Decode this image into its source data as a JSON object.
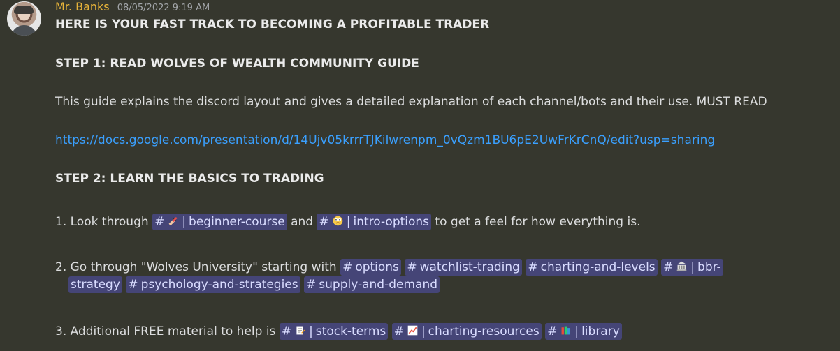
{
  "message": {
    "username": "Mr. Banks",
    "timestamp": "08/05/2022 9:19 AM",
    "title": "HERE IS YOUR FAST TRACK TO BECOMING A PROFITABLE TRADER",
    "step1_heading": "STEP 1:  READ WOLVES OF WEALTH COMMUNITY GUIDE",
    "step1_text": "This guide explains the discord layout and gives a detailed explanation of each channel/bots and their use. MUST READ",
    "guide_link": "https://docs.google.com/presentation/d/14Ujv05krrrTJKilwrenpm_0vQzm1BU6pE2UwFrKrCnQ/edit?usp=sharing",
    "step2_heading": "STEP 2: LEARN THE BASICS TO TRADING",
    "item1": {
      "prefix": "1. Look through",
      "middle": "and",
      "suffix": "to get a feel for how everything is.",
      "channel_a": "beginner-course",
      "channel_b": "intro-options"
    },
    "item2": {
      "prefix": "2. Go through \"Wolves University\" starting with",
      "channel_a": "options",
      "channel_b": "watchlist-trading",
      "channel_c": "charting-and-levels",
      "channel_d_start": "bbr-",
      "channel_d_end": "strategy",
      "channel_e": "psychology-and-strategies",
      "channel_f": "supply-and-demand"
    },
    "item3": {
      "prefix": "3. Additional FREE material to help is",
      "channel_a": "stock-terms",
      "channel_b": "charting-resources",
      "channel_c": "library"
    }
  },
  "icons": {
    "hash": "#",
    "separator": "|"
  }
}
